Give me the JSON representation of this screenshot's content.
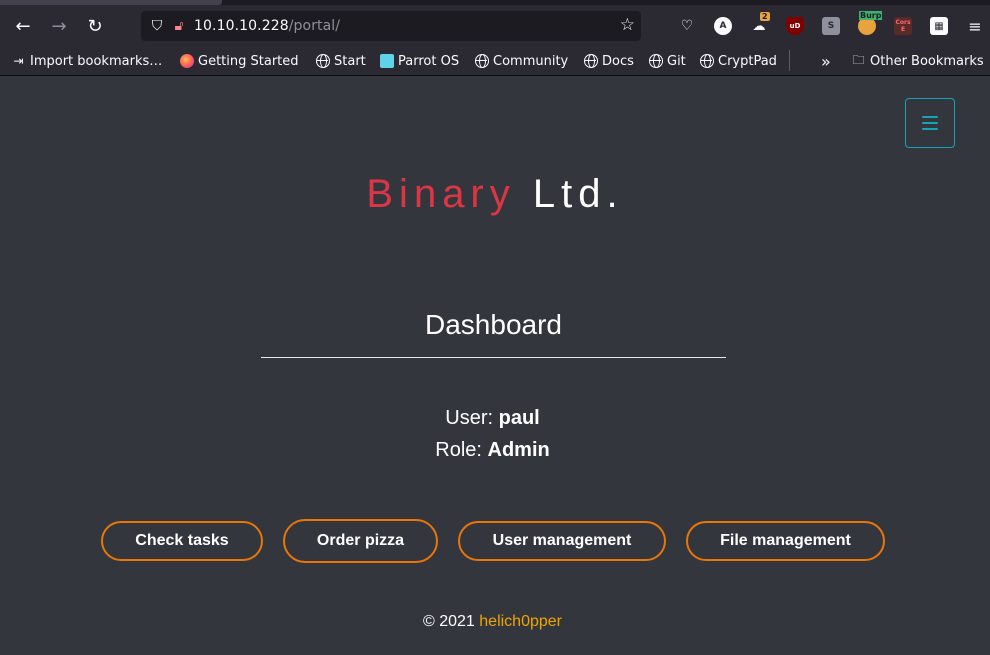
{
  "browser": {
    "url_host": "10.10.10.228",
    "url_path": "/portal/",
    "extensions": {
      "account_badge": "A",
      "notification_count": "2",
      "ublock_label": "uD",
      "s_ext_label": "S",
      "burp_label": "Burp",
      "cors_label": "Cors E"
    },
    "bookmarks": [
      {
        "label": "Import bookmarks…",
        "icon": "import-icon"
      },
      {
        "label": "Getting Started",
        "icon": "firefox-icon"
      },
      {
        "label": "Start",
        "icon": "globe-icon"
      },
      {
        "label": "Parrot OS",
        "icon": "parrot-icon"
      },
      {
        "label": "Community",
        "icon": "globe-icon"
      },
      {
        "label": "Docs",
        "icon": "globe-icon"
      },
      {
        "label": "Git",
        "icon": "globe-icon"
      },
      {
        "label": "CryptPad",
        "icon": "globe-icon"
      }
    ],
    "other_bookmarks": "Other Bookmarks"
  },
  "page": {
    "brand_part1": "Binary",
    "brand_part2": "Ltd.",
    "title": "Dashboard",
    "user_label": "User:",
    "user_value": "paul",
    "role_label": "Role:",
    "role_value": "Admin",
    "buttons": {
      "check_tasks": "Check tasks",
      "order_pizza": "Order pizza",
      "user_management": "User management",
      "file_management": "File management"
    },
    "footer_prefix": "© 2021",
    "footer_author": "helich0pper"
  },
  "colors": {
    "background": "#33373d",
    "brand_accent": "#dc3545",
    "button_border": "#e8760a",
    "footer_link": "#f0a500",
    "toggler": "#17a2b8"
  }
}
